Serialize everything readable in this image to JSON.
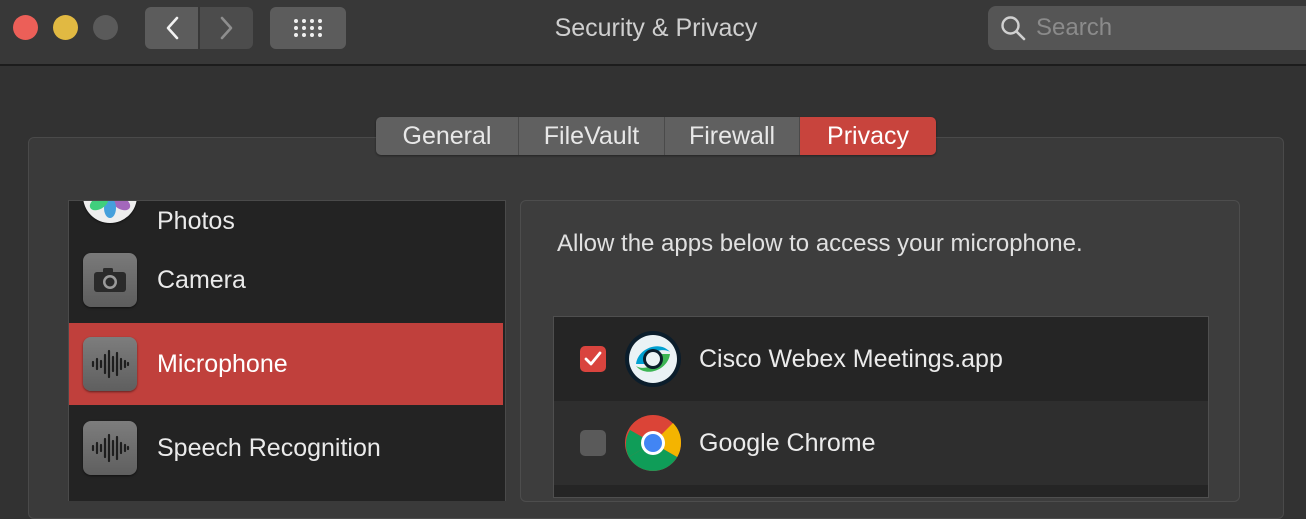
{
  "window": {
    "title": "Security & Privacy"
  },
  "toolbar": {
    "back_icon": "chevron-left-icon",
    "forward_icon": "chevron-right-icon",
    "grid_icon": "grid-icon"
  },
  "search": {
    "placeholder": "Search",
    "value": ""
  },
  "tabs": [
    {
      "label": "General",
      "selected": false
    },
    {
      "label": "FileVault",
      "selected": false
    },
    {
      "label": "Firewall",
      "selected": false
    },
    {
      "label": "Privacy",
      "selected": true
    }
  ],
  "sidebar": {
    "items": [
      {
        "label": "Photos",
        "icon": "photos-icon"
      },
      {
        "label": "Camera",
        "icon": "camera-icon"
      },
      {
        "label": "Microphone",
        "icon": "microphone-icon",
        "selected": true
      },
      {
        "label": "Speech Recognition",
        "icon": "speech-recognition-icon"
      }
    ]
  },
  "main": {
    "description": "Allow the apps below to access your microphone.",
    "apps": [
      {
        "label": "Cisco Webex Meetings.app",
        "checked": true,
        "icon": "webex-icon"
      },
      {
        "label": "Google Chrome",
        "checked": false,
        "icon": "chrome-icon"
      }
    ]
  },
  "colors": {
    "accent": "#c8443d",
    "selected_row": "#c0403c",
    "checkbox_checked": "#d9443e",
    "window_bg": "#323232"
  }
}
